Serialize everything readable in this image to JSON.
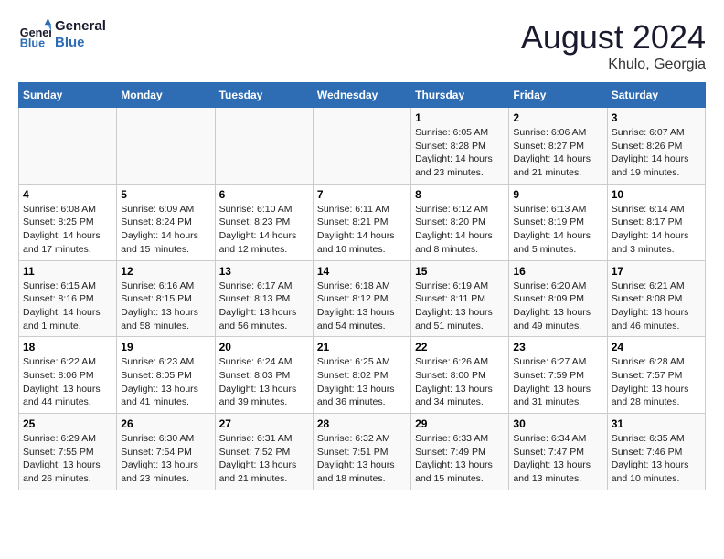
{
  "logo": {
    "line1": "General",
    "line2": "Blue"
  },
  "title": "August 2024",
  "location": "Khulo, Georgia",
  "days_of_week": [
    "Sunday",
    "Monday",
    "Tuesday",
    "Wednesday",
    "Thursday",
    "Friday",
    "Saturday"
  ],
  "weeks": [
    [
      {
        "day": "",
        "info": ""
      },
      {
        "day": "",
        "info": ""
      },
      {
        "day": "",
        "info": ""
      },
      {
        "day": "",
        "info": ""
      },
      {
        "day": "1",
        "info": "Sunrise: 6:05 AM\nSunset: 8:28 PM\nDaylight: 14 hours\nand 23 minutes."
      },
      {
        "day": "2",
        "info": "Sunrise: 6:06 AM\nSunset: 8:27 PM\nDaylight: 14 hours\nand 21 minutes."
      },
      {
        "day": "3",
        "info": "Sunrise: 6:07 AM\nSunset: 8:26 PM\nDaylight: 14 hours\nand 19 minutes."
      }
    ],
    [
      {
        "day": "4",
        "info": "Sunrise: 6:08 AM\nSunset: 8:25 PM\nDaylight: 14 hours\nand 17 minutes."
      },
      {
        "day": "5",
        "info": "Sunrise: 6:09 AM\nSunset: 8:24 PM\nDaylight: 14 hours\nand 15 minutes."
      },
      {
        "day": "6",
        "info": "Sunrise: 6:10 AM\nSunset: 8:23 PM\nDaylight: 14 hours\nand 12 minutes."
      },
      {
        "day": "7",
        "info": "Sunrise: 6:11 AM\nSunset: 8:21 PM\nDaylight: 14 hours\nand 10 minutes."
      },
      {
        "day": "8",
        "info": "Sunrise: 6:12 AM\nSunset: 8:20 PM\nDaylight: 14 hours\nand 8 minutes."
      },
      {
        "day": "9",
        "info": "Sunrise: 6:13 AM\nSunset: 8:19 PM\nDaylight: 14 hours\nand 5 minutes."
      },
      {
        "day": "10",
        "info": "Sunrise: 6:14 AM\nSunset: 8:17 PM\nDaylight: 14 hours\nand 3 minutes."
      }
    ],
    [
      {
        "day": "11",
        "info": "Sunrise: 6:15 AM\nSunset: 8:16 PM\nDaylight: 14 hours\nand 1 minute."
      },
      {
        "day": "12",
        "info": "Sunrise: 6:16 AM\nSunset: 8:15 PM\nDaylight: 13 hours\nand 58 minutes."
      },
      {
        "day": "13",
        "info": "Sunrise: 6:17 AM\nSunset: 8:13 PM\nDaylight: 13 hours\nand 56 minutes."
      },
      {
        "day": "14",
        "info": "Sunrise: 6:18 AM\nSunset: 8:12 PM\nDaylight: 13 hours\nand 54 minutes."
      },
      {
        "day": "15",
        "info": "Sunrise: 6:19 AM\nSunset: 8:11 PM\nDaylight: 13 hours\nand 51 minutes."
      },
      {
        "day": "16",
        "info": "Sunrise: 6:20 AM\nSunset: 8:09 PM\nDaylight: 13 hours\nand 49 minutes."
      },
      {
        "day": "17",
        "info": "Sunrise: 6:21 AM\nSunset: 8:08 PM\nDaylight: 13 hours\nand 46 minutes."
      }
    ],
    [
      {
        "day": "18",
        "info": "Sunrise: 6:22 AM\nSunset: 8:06 PM\nDaylight: 13 hours\nand 44 minutes."
      },
      {
        "day": "19",
        "info": "Sunrise: 6:23 AM\nSunset: 8:05 PM\nDaylight: 13 hours\nand 41 minutes."
      },
      {
        "day": "20",
        "info": "Sunrise: 6:24 AM\nSunset: 8:03 PM\nDaylight: 13 hours\nand 39 minutes."
      },
      {
        "day": "21",
        "info": "Sunrise: 6:25 AM\nSunset: 8:02 PM\nDaylight: 13 hours\nand 36 minutes."
      },
      {
        "day": "22",
        "info": "Sunrise: 6:26 AM\nSunset: 8:00 PM\nDaylight: 13 hours\nand 34 minutes."
      },
      {
        "day": "23",
        "info": "Sunrise: 6:27 AM\nSunset: 7:59 PM\nDaylight: 13 hours\nand 31 minutes."
      },
      {
        "day": "24",
        "info": "Sunrise: 6:28 AM\nSunset: 7:57 PM\nDaylight: 13 hours\nand 28 minutes."
      }
    ],
    [
      {
        "day": "25",
        "info": "Sunrise: 6:29 AM\nSunset: 7:55 PM\nDaylight: 13 hours\nand 26 minutes."
      },
      {
        "day": "26",
        "info": "Sunrise: 6:30 AM\nSunset: 7:54 PM\nDaylight: 13 hours\nand 23 minutes."
      },
      {
        "day": "27",
        "info": "Sunrise: 6:31 AM\nSunset: 7:52 PM\nDaylight: 13 hours\nand 21 minutes."
      },
      {
        "day": "28",
        "info": "Sunrise: 6:32 AM\nSunset: 7:51 PM\nDaylight: 13 hours\nand 18 minutes."
      },
      {
        "day": "29",
        "info": "Sunrise: 6:33 AM\nSunset: 7:49 PM\nDaylight: 13 hours\nand 15 minutes."
      },
      {
        "day": "30",
        "info": "Sunrise: 6:34 AM\nSunset: 7:47 PM\nDaylight: 13 hours\nand 13 minutes."
      },
      {
        "day": "31",
        "info": "Sunrise: 6:35 AM\nSunset: 7:46 PM\nDaylight: 13 hours\nand 10 minutes."
      }
    ]
  ]
}
